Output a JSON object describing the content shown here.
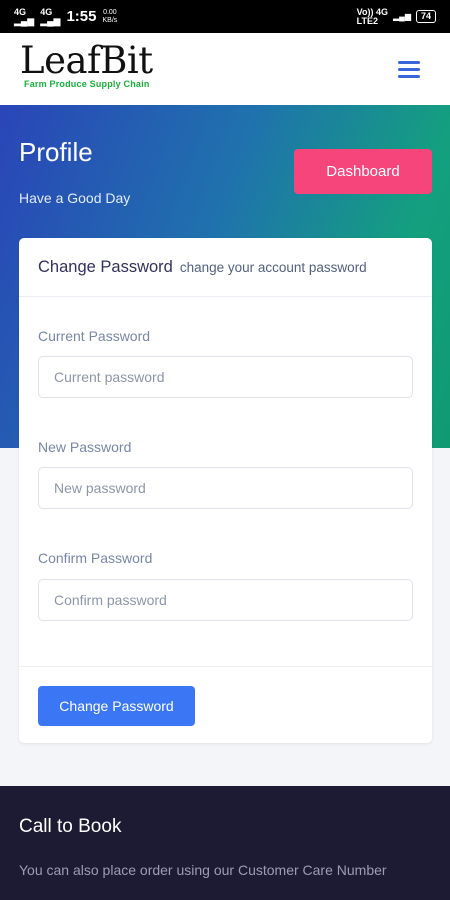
{
  "status_bar": {
    "signal_left": "4G",
    "signal_left_2": "4G",
    "time": "1:55",
    "speed_value": "0.00",
    "speed_unit": "KB/s",
    "carrier": "Vo)) 4G",
    "lte": "LTE2",
    "battery": "74"
  },
  "header": {
    "logo_title": "LeafBit",
    "logo_subtitle": "Farm Produce Supply Chain",
    "menu_icon": "hamburger-icon"
  },
  "hero": {
    "title": "Profile",
    "subtitle": "Have a Good Day",
    "dashboard_button": "Dashboard"
  },
  "card": {
    "title": "Change Password",
    "subtitle": "change your account password",
    "fields": [
      {
        "label": "Current Password",
        "placeholder": "Current password",
        "value": ""
      },
      {
        "label": "New Password",
        "placeholder": "New password",
        "value": ""
      },
      {
        "label": "Confirm Password",
        "placeholder": "Confirm password",
        "value": ""
      }
    ],
    "submit_button": "Change Password"
  },
  "footer": {
    "title": "Call to Book",
    "text": "You can also place order using our Customer Care Number"
  },
  "colors": {
    "accent_blue": "#3b77f4",
    "dashboard_pink": "#f5457a",
    "logo_green": "#18b23a",
    "footer_bg": "#1d1a33"
  }
}
